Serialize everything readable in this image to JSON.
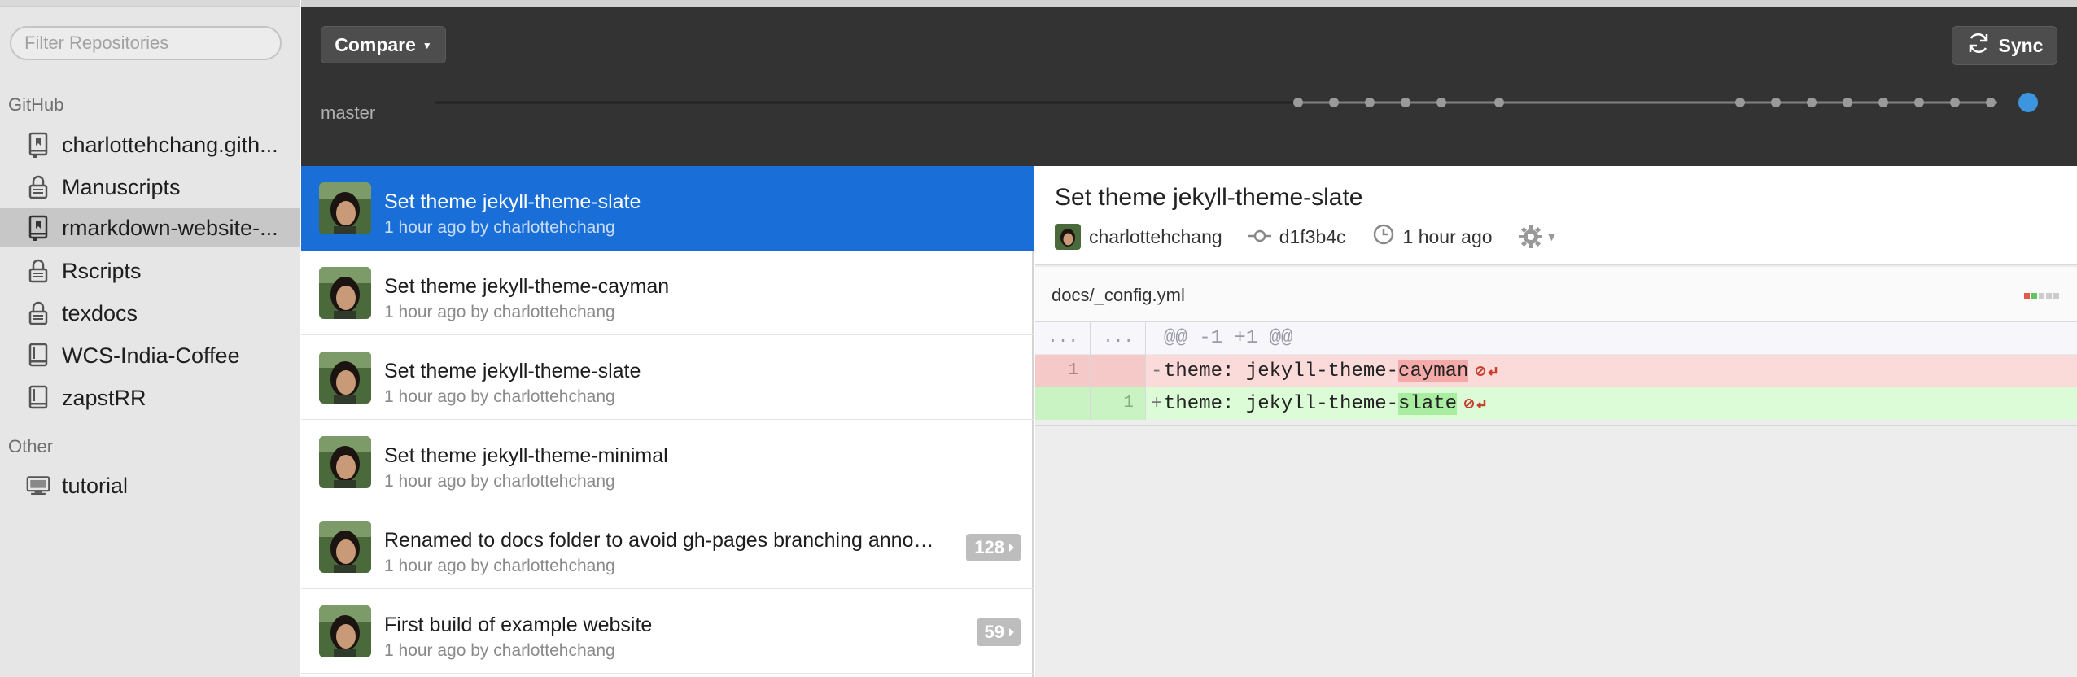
{
  "sidebar": {
    "filter_placeholder": "Filter Repositories",
    "sections": [
      {
        "title": "GitHub",
        "repos": [
          {
            "label": "charlottehchang.gith...",
            "icon": "repo-icon",
            "selected": false
          },
          {
            "label": "Manuscripts",
            "icon": "lock-icon",
            "selected": false
          },
          {
            "label": "rmarkdown-website-...",
            "icon": "repo-icon",
            "selected": true
          },
          {
            "label": "Rscripts",
            "icon": "lock-icon",
            "selected": false
          },
          {
            "label": "texdocs",
            "icon": "lock-icon",
            "selected": false
          },
          {
            "label": "WCS-India-Coffee",
            "icon": "book-icon",
            "selected": false
          },
          {
            "label": "zapstRR",
            "icon": "book-icon",
            "selected": false
          }
        ]
      },
      {
        "title": "Other",
        "repos": [
          {
            "label": "tutorial",
            "icon": "computer-icon",
            "selected": false
          }
        ]
      }
    ]
  },
  "toolbar": {
    "compare_label": "Compare",
    "sync_label": "Sync",
    "branch": "master"
  },
  "commits": [
    {
      "title": "Set theme jekyll-theme-slate",
      "meta": "1 hour ago by charlottehchang",
      "selected": true,
      "badge": null
    },
    {
      "title": "Set theme jekyll-theme-cayman",
      "meta": "1 hour ago by charlottehchang",
      "selected": false,
      "badge": null
    },
    {
      "title": "Set theme jekyll-theme-slate",
      "meta": "1 hour ago by charlottehchang",
      "selected": false,
      "badge": null
    },
    {
      "title": "Set theme jekyll-theme-minimal",
      "meta": "1 hour ago by charlottehchang",
      "selected": false,
      "badge": null
    },
    {
      "title": "Renamed to docs folder to avoid gh-pages branching annoy...",
      "meta": "1 hour ago by charlottehchang",
      "selected": false,
      "badge": "128"
    },
    {
      "title": "First build of example website",
      "meta": "1 hour ago by charlottehchang",
      "selected": false,
      "badge": "59"
    }
  ],
  "detail": {
    "title": "Set theme jekyll-theme-slate",
    "author": "charlottehchang",
    "sha": "d1f3b4c",
    "time": "1 hour ago",
    "file": "docs/_config.yml",
    "hunk_ln_old": "...",
    "hunk_ln_new": "...",
    "hunk": "@@ -1 +1 @@",
    "del_ln": "1",
    "add_ln": "1",
    "del_mark": "-",
    "add_mark": "+",
    "del_prefix": "theme: jekyll-theme-",
    "del_changed": "cayman",
    "add_prefix": "theme: jekyll-theme-",
    "add_changed": "slate"
  },
  "colors": {
    "selected_blue": "#1a6ed8",
    "timeline_active": "#3d95e0"
  }
}
